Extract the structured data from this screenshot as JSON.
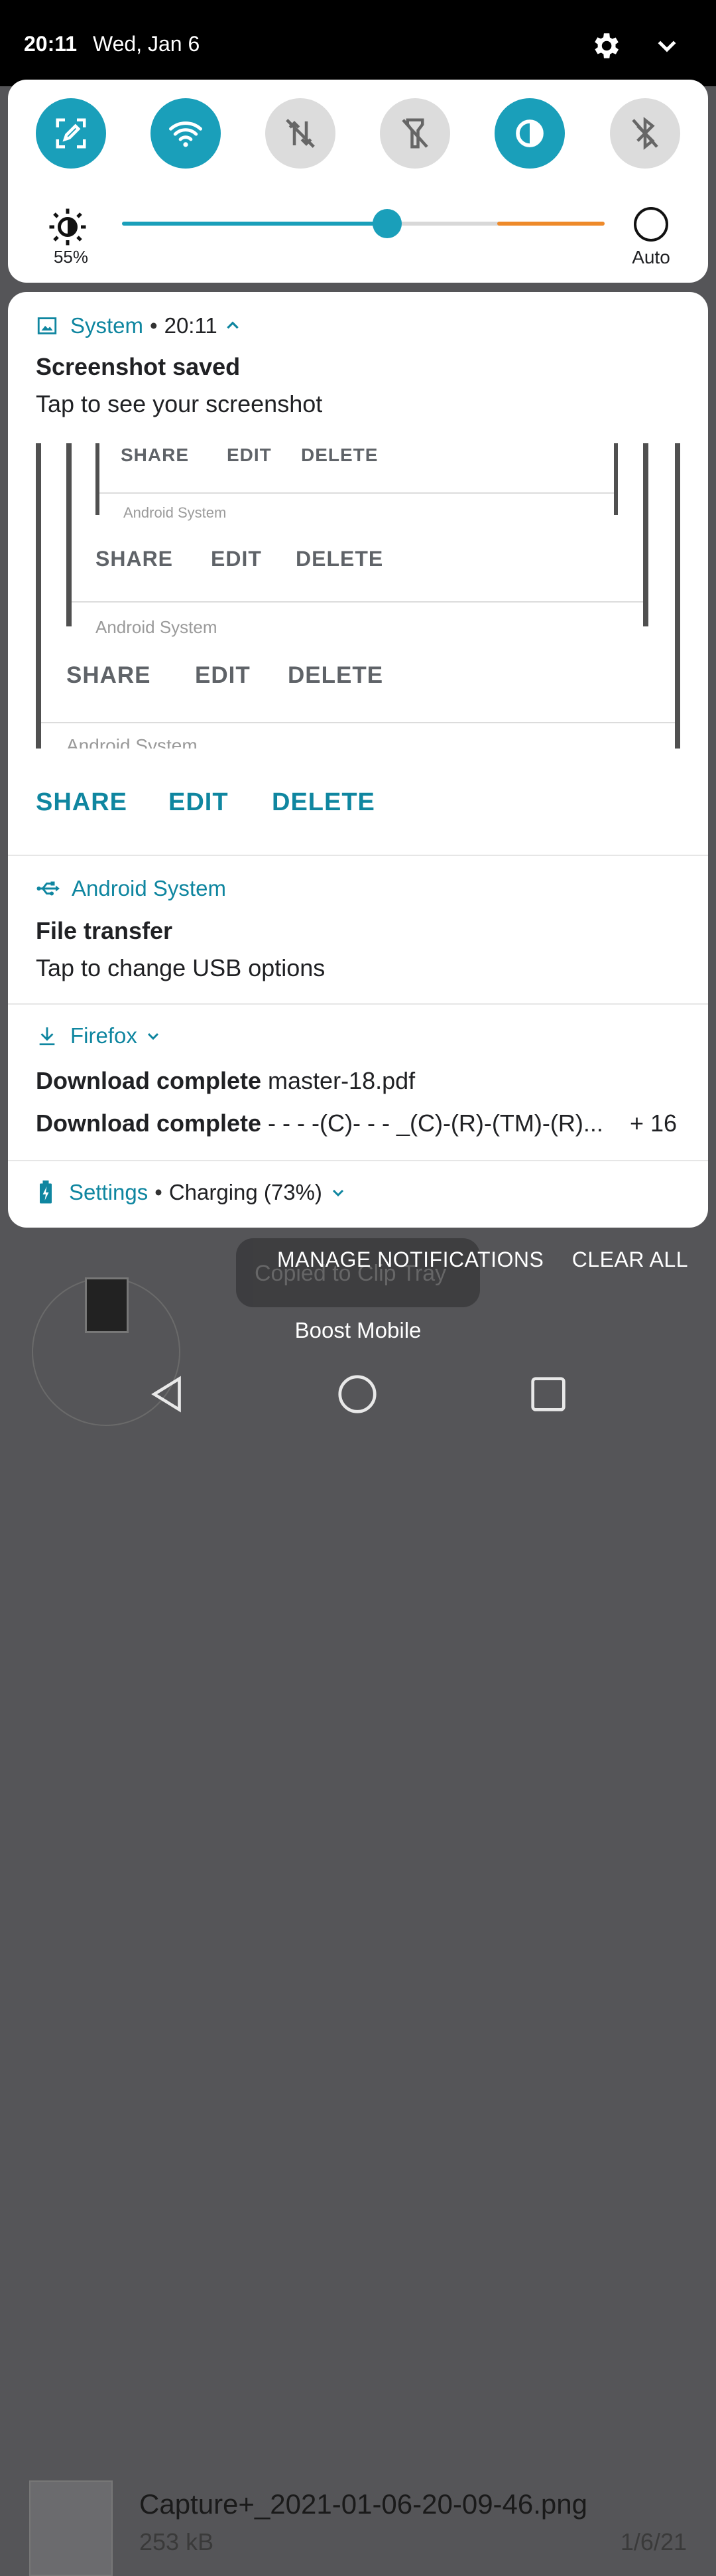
{
  "status_bar": {
    "time": "20:11",
    "date": "Wed, Jan 6",
    "settings_icon": "gear-icon",
    "expand_icon": "chevron-down-icon"
  },
  "quick_settings": {
    "tiles": [
      {
        "name": "screen-capture",
        "icon": "edit-screen-icon",
        "state": "on"
      },
      {
        "name": "wifi",
        "icon": "wifi-icon",
        "state": "on"
      },
      {
        "name": "mobile-data",
        "icon": "data-off-icon",
        "state": "off"
      },
      {
        "name": "flashlight",
        "icon": "flashlight-off-icon",
        "state": "off"
      },
      {
        "name": "dark-mode",
        "icon": "contrast-icon",
        "state": "on"
      },
      {
        "name": "bluetooth",
        "icon": "bluetooth-off-icon",
        "state": "off"
      }
    ],
    "brightness": {
      "percent_label": "55%",
      "level": 0.55,
      "auto_label": "Auto"
    },
    "accent": "#1a9fba"
  },
  "notifications": {
    "screenshot": {
      "app": "System",
      "time": "20:11",
      "title": "Screenshot saved",
      "text": "Tap to see your screenshot",
      "actions": [
        "SHARE",
        "EDIT",
        "DELETE"
      ],
      "preview_footer": "Android System"
    },
    "usb": {
      "app": "Android System",
      "title": "File transfer",
      "text": "Tap to change USB options"
    },
    "firefox": {
      "app": "Firefox",
      "line1_bold": "Download complete",
      "line1_text": "master-18.pdf",
      "line2_bold": "Download complete",
      "line2_text": "- - - -(C)- - - _(C)-(R)-(TM)-(R)...",
      "more": "+ 16"
    },
    "settings": {
      "app": "Settings",
      "text": "Charging (73%)"
    }
  },
  "footer": {
    "manage": "MANAGE NOTIFICATIONS",
    "clear_all": "CLEAR ALL",
    "carrier": "Boost Mobile"
  },
  "background": {
    "file_name": "Capture+_2021-01-06-20-09-46.png",
    "file_size": "253 kB",
    "file_date": "1/6/21",
    "toast": "Copied to Clip Tray"
  }
}
